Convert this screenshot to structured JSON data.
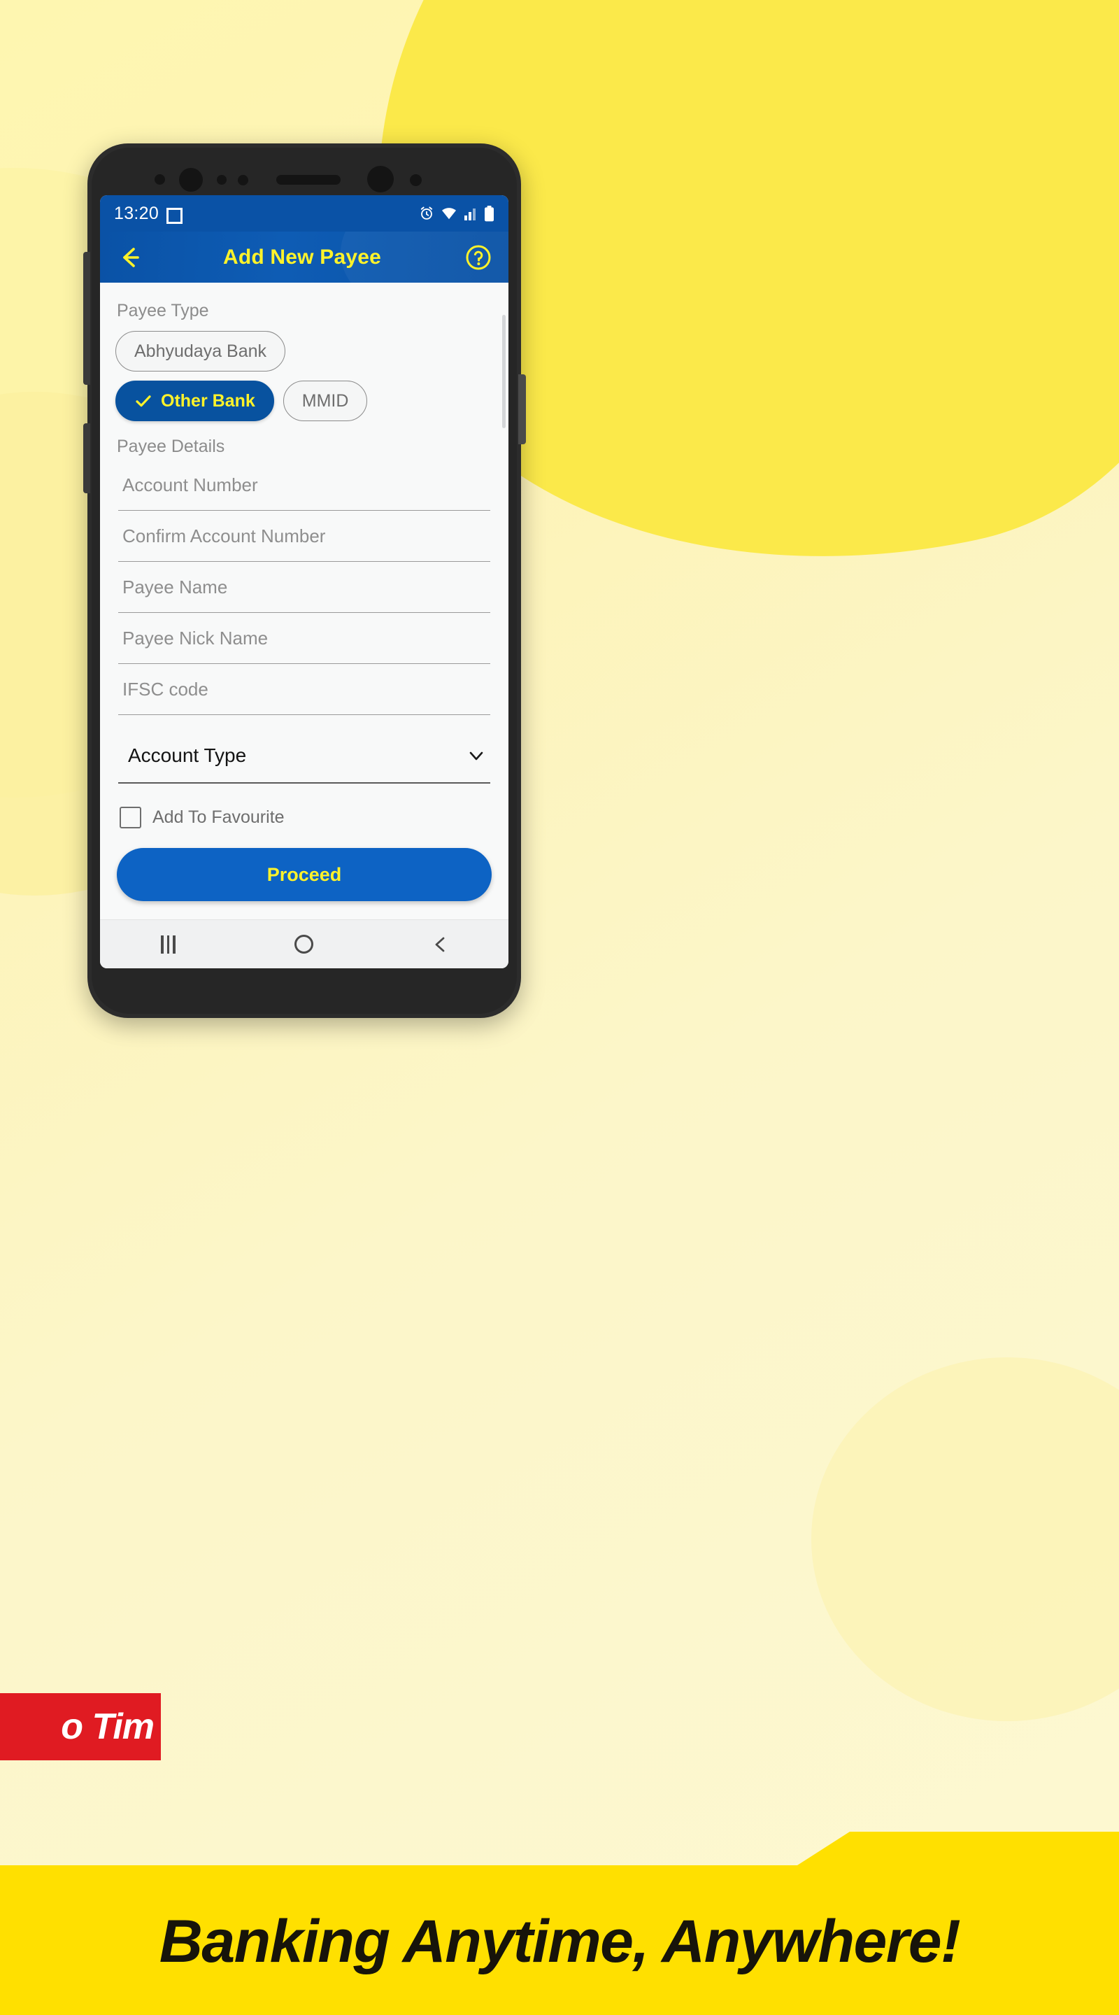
{
  "promo": {
    "red_banner_text": "o Tim",
    "ribbon_text": "Banking Anytime, Anywhere!"
  },
  "statusbar": {
    "time": "13:20",
    "crop_icon": "crop-brackets-icon",
    "icons": [
      "alarm-icon",
      "wifi-icon",
      "signal-icon",
      "battery-icon"
    ]
  },
  "appbar": {
    "back_icon": "back-arrow-icon",
    "title": "Add New Payee",
    "help_icon": "help-circle-icon"
  },
  "form": {
    "payee_type_label": "Payee Type",
    "payee_type_options": [
      {
        "label": "Abhyudaya Bank",
        "selected": false
      },
      {
        "label": "Other Bank",
        "selected": true
      },
      {
        "label": "MMID",
        "selected": false
      }
    ],
    "payee_details_label": "Payee Details",
    "fields": [
      {
        "name": "account-number",
        "placeholder": "Account Number",
        "value": ""
      },
      {
        "name": "confirm-account-number",
        "placeholder": "Confirm Account Number",
        "value": ""
      },
      {
        "name": "payee-name",
        "placeholder": "Payee Name",
        "value": ""
      },
      {
        "name": "payee-nick-name",
        "placeholder": "Payee Nick Name",
        "value": ""
      },
      {
        "name": "ifsc-code",
        "placeholder": "IFSC code",
        "value": ""
      }
    ],
    "account_type": {
      "label": "Account Type",
      "chevron_icon": "chevron-down-icon"
    },
    "favourite": {
      "label": "Add To Favourite",
      "checked": false
    },
    "proceed_label": "Proceed"
  },
  "navbar": {
    "recents_icon": "recents-icon",
    "home_icon": "home-circle-icon",
    "back_icon": "nav-back-icon"
  },
  "colors": {
    "primary_blue": "#0A52A6",
    "button_blue": "#0D63C4",
    "accent_yellow": "#FFF32A",
    "promo_yellow": "#FFE000",
    "promo_red": "#E01B22"
  }
}
